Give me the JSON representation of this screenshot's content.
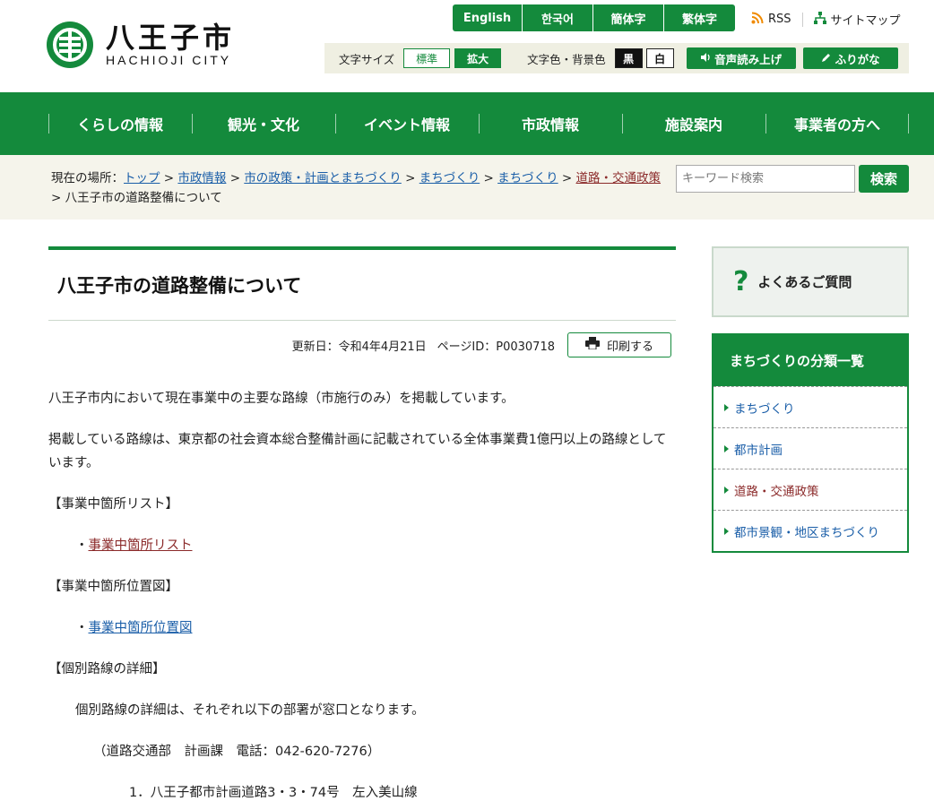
{
  "header": {
    "logo_jp": "八王子市",
    "logo_en": "HACHIOJI CITY",
    "languages": [
      "English",
      "한국어",
      "簡体字",
      "繁体字"
    ],
    "rss": "RSS",
    "sitemap": "サイトマップ",
    "font_size_label": "文字サイズ",
    "size_normal": "標準",
    "size_large": "拡大",
    "color_label": "文字色・背景色",
    "color_black": "黒",
    "color_white": "白",
    "read_aloud": "音声読み上げ",
    "furigana": "ふりがな"
  },
  "nav": [
    "くらしの情報",
    "観光・文化",
    "イベント情報",
    "市政情報",
    "施設案内",
    "事業者の方へ"
  ],
  "breadcrumb": {
    "prefix": "現在の場所：",
    "items": [
      "トップ",
      "市政情報",
      "市の政策・計画とまちづくり",
      "まちづくり",
      "まちづくり",
      "道路・交通政策"
    ],
    "current": "八王子市の道路整備について",
    "sep": " > "
  },
  "search": {
    "placeholder": "キーワード検索",
    "button": "検索"
  },
  "page": {
    "title": "八王子市の道路整備について",
    "updated": "更新日：令和4年4月21日",
    "page_id": "ページID：P0030718",
    "print": "印刷する",
    "para1": "八王子市内において現在事業中の主要な路線（市施行のみ）を掲載しています。",
    "para2": "掲載している路線は、東京都の社会資本総合整備計画に記載されている全体事業費1億円以上の路線としています。",
    "h_list": "【事業中箇所リスト】",
    "bullet": "・",
    "link_list": "事業中箇所リスト",
    "h_map": "【事業中箇所位置図】",
    "link_map": "事業中箇所位置図",
    "h_detail": "【個別路線の詳細】",
    "detail_text": "個別路線の詳細は、それぞれ以下の部署が窓口となります。",
    "contact": "（道路交通部　計画課　電話：042-620-7276）",
    "route1": "1．八王子都市計画道路3・3・74号　左入美山線"
  },
  "sidebar": {
    "faq": "よくあるご質問",
    "category_title": "まちづくりの分類一覧",
    "categories": [
      "まちづくり",
      "都市計画",
      "道路・交通政策",
      "都市景観・地区まちづくり"
    ]
  }
}
